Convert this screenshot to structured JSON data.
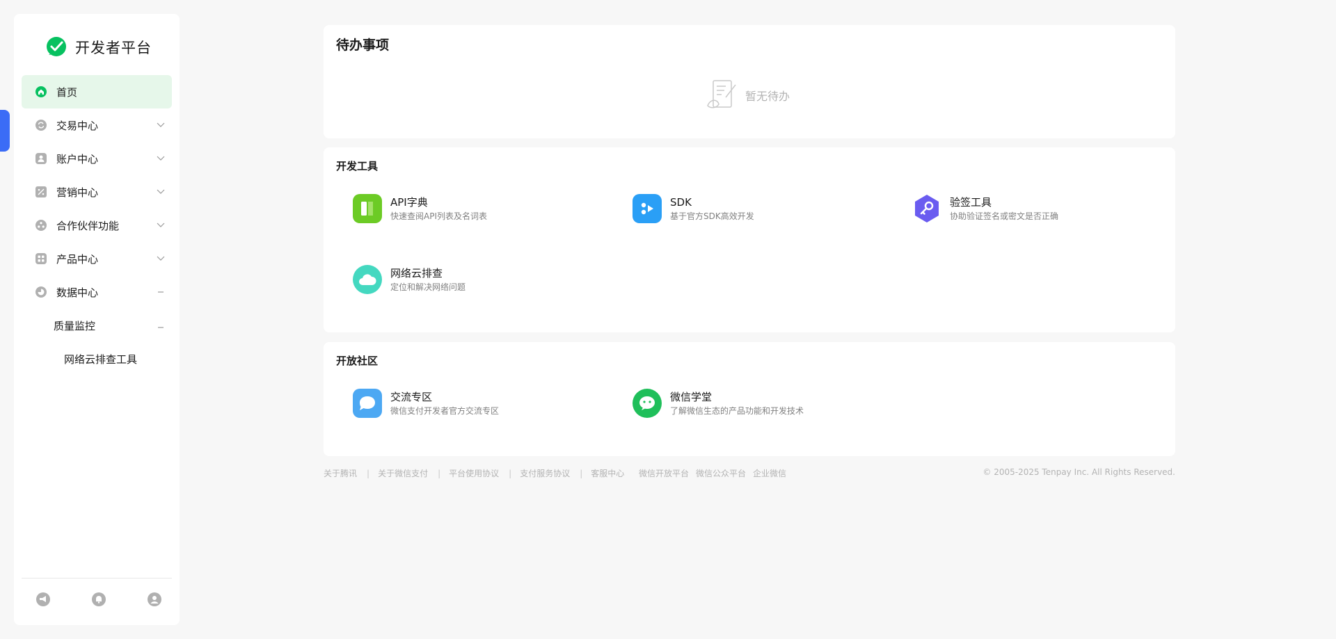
{
  "brand": {
    "title": "开发者平台"
  },
  "sidebar": {
    "items": [
      {
        "label": "首页",
        "icon": "home-icon",
        "active": true
      },
      {
        "label": "交易中心",
        "icon": "exchange-icon"
      },
      {
        "label": "账户中心",
        "icon": "account-icon"
      },
      {
        "label": "营销中心",
        "icon": "discount-icon"
      },
      {
        "label": "合作伙伴功能",
        "icon": "partner-icon"
      },
      {
        "label": "产品中心",
        "icon": "product-grid-icon"
      },
      {
        "label": "数据中心",
        "icon": "data-pie-icon"
      }
    ],
    "sub": {
      "label": "质量监控"
    },
    "subsub": {
      "label": "网络云排查工具"
    }
  },
  "todo": {
    "title": "待办事项",
    "empty_text": "暂无待办"
  },
  "tools": {
    "title": "开发工具",
    "items": [
      {
        "name": "API字典",
        "desc": "快速查阅API列表及名词表",
        "color": "#6ccb25",
        "icon": "book-icon"
      },
      {
        "name": "SDK",
        "desc": "基于官方SDK高效开发",
        "color": "#2a9ff6",
        "icon": "sdk-icon"
      },
      {
        "name": "验签工具",
        "desc": "协助验证签名或密文是否正确",
        "color": "#6a5cf0",
        "icon": "key-icon"
      },
      {
        "name": "网络云排查",
        "desc": "定位和解决网络问题",
        "color": "#44d8c0",
        "icon": "cloud-icon"
      }
    ]
  },
  "community": {
    "title": "开放社区",
    "items": [
      {
        "name": "交流专区",
        "desc": "微信支付开发者官方交流专区",
        "color": "#4ca8f3",
        "icon": "chat-bubble-icon"
      },
      {
        "name": "微信学堂",
        "desc": "了解微信生态的产品功能和开发技术",
        "color": "#1fbf5a",
        "icon": "wechat-icon"
      }
    ]
  },
  "footer": {
    "links": [
      "关于腾讯",
      "关于微信支付",
      "平台使用协议",
      "支付服务协议",
      "客服中心"
    ],
    "links2": [
      "微信开放平台",
      "微信公众平台",
      "企业微信"
    ],
    "copyright": "© 2005-2025 Tenpay Inc. All Rights Reserved."
  },
  "colors": {
    "accent_green": "#07c160",
    "active_bg": "#e6f7ea",
    "edge_tab": "#3b6cf6"
  }
}
